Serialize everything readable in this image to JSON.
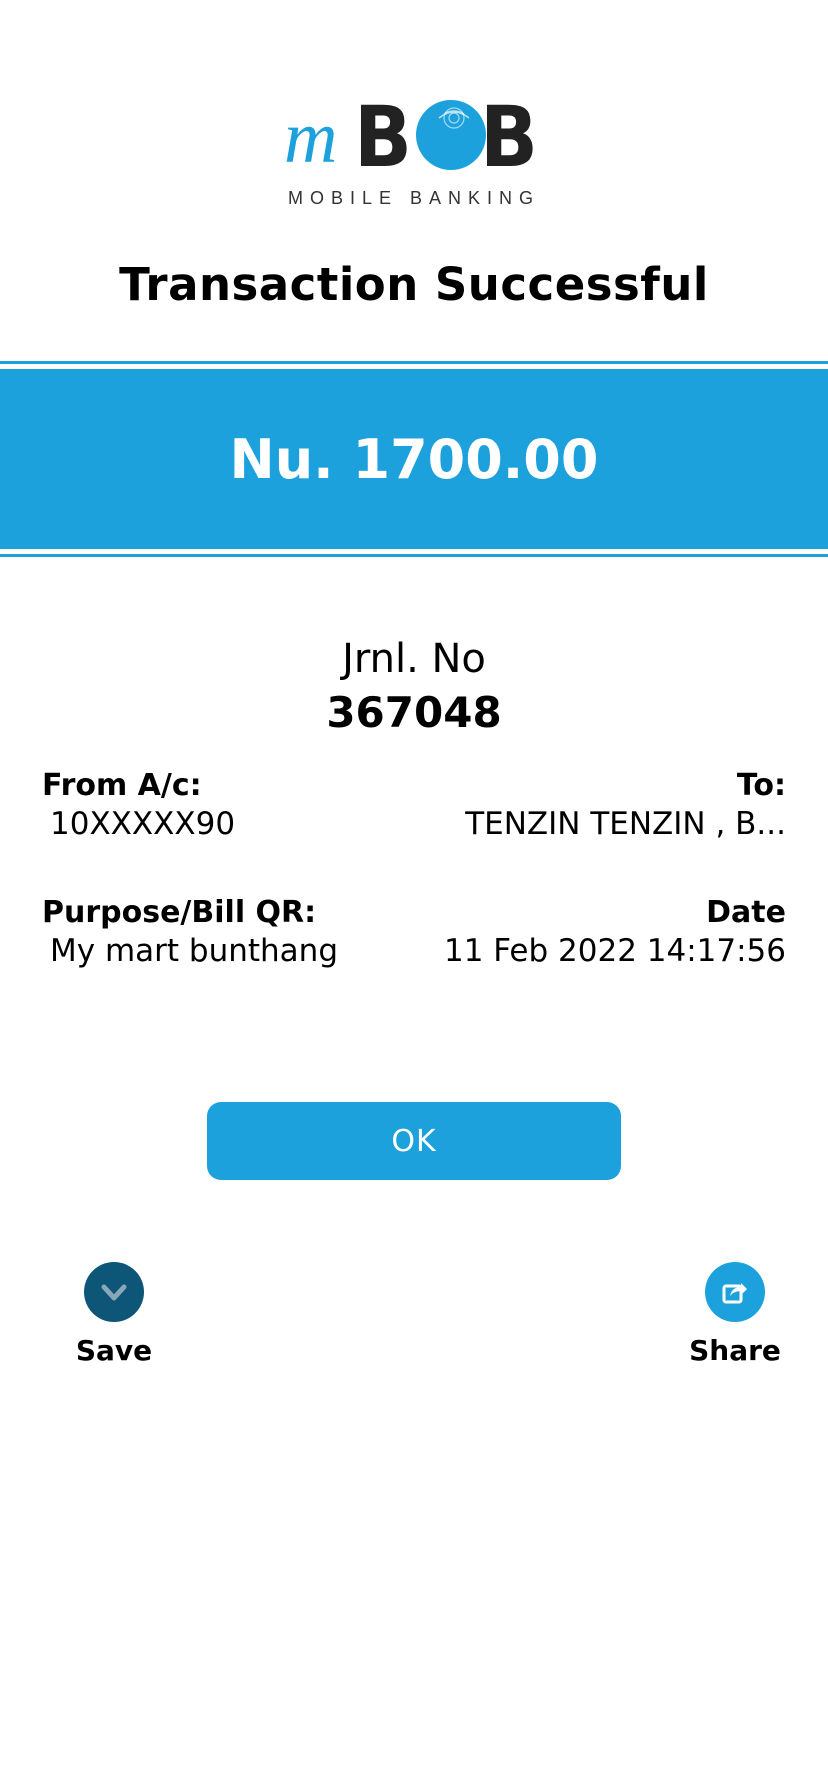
{
  "logo": {
    "brand_prefix": "m",
    "brand_main": "BOB",
    "subtitle": "MOBILE BANKING"
  },
  "title": "Transaction Successful",
  "amount": "Nu. 1700.00",
  "journal": {
    "label": "Jrnl. No",
    "value": "367048"
  },
  "from": {
    "label": "From A/c:",
    "value": "10XXXXX90"
  },
  "to": {
    "label": "To:",
    "value": "TENZIN  TENZIN , B..."
  },
  "purpose": {
    "label": "Purpose/Bill QR:",
    "value": "My mart bunthang"
  },
  "date": {
    "label": "Date",
    "value": "11 Feb 2022 14:17:56"
  },
  "actions": {
    "ok_label": "OK",
    "save_label": "Save",
    "share_label": "Share"
  },
  "colors": {
    "accent": "#1da1dc",
    "save_circle": "#0d5678",
    "text": "#000000"
  }
}
